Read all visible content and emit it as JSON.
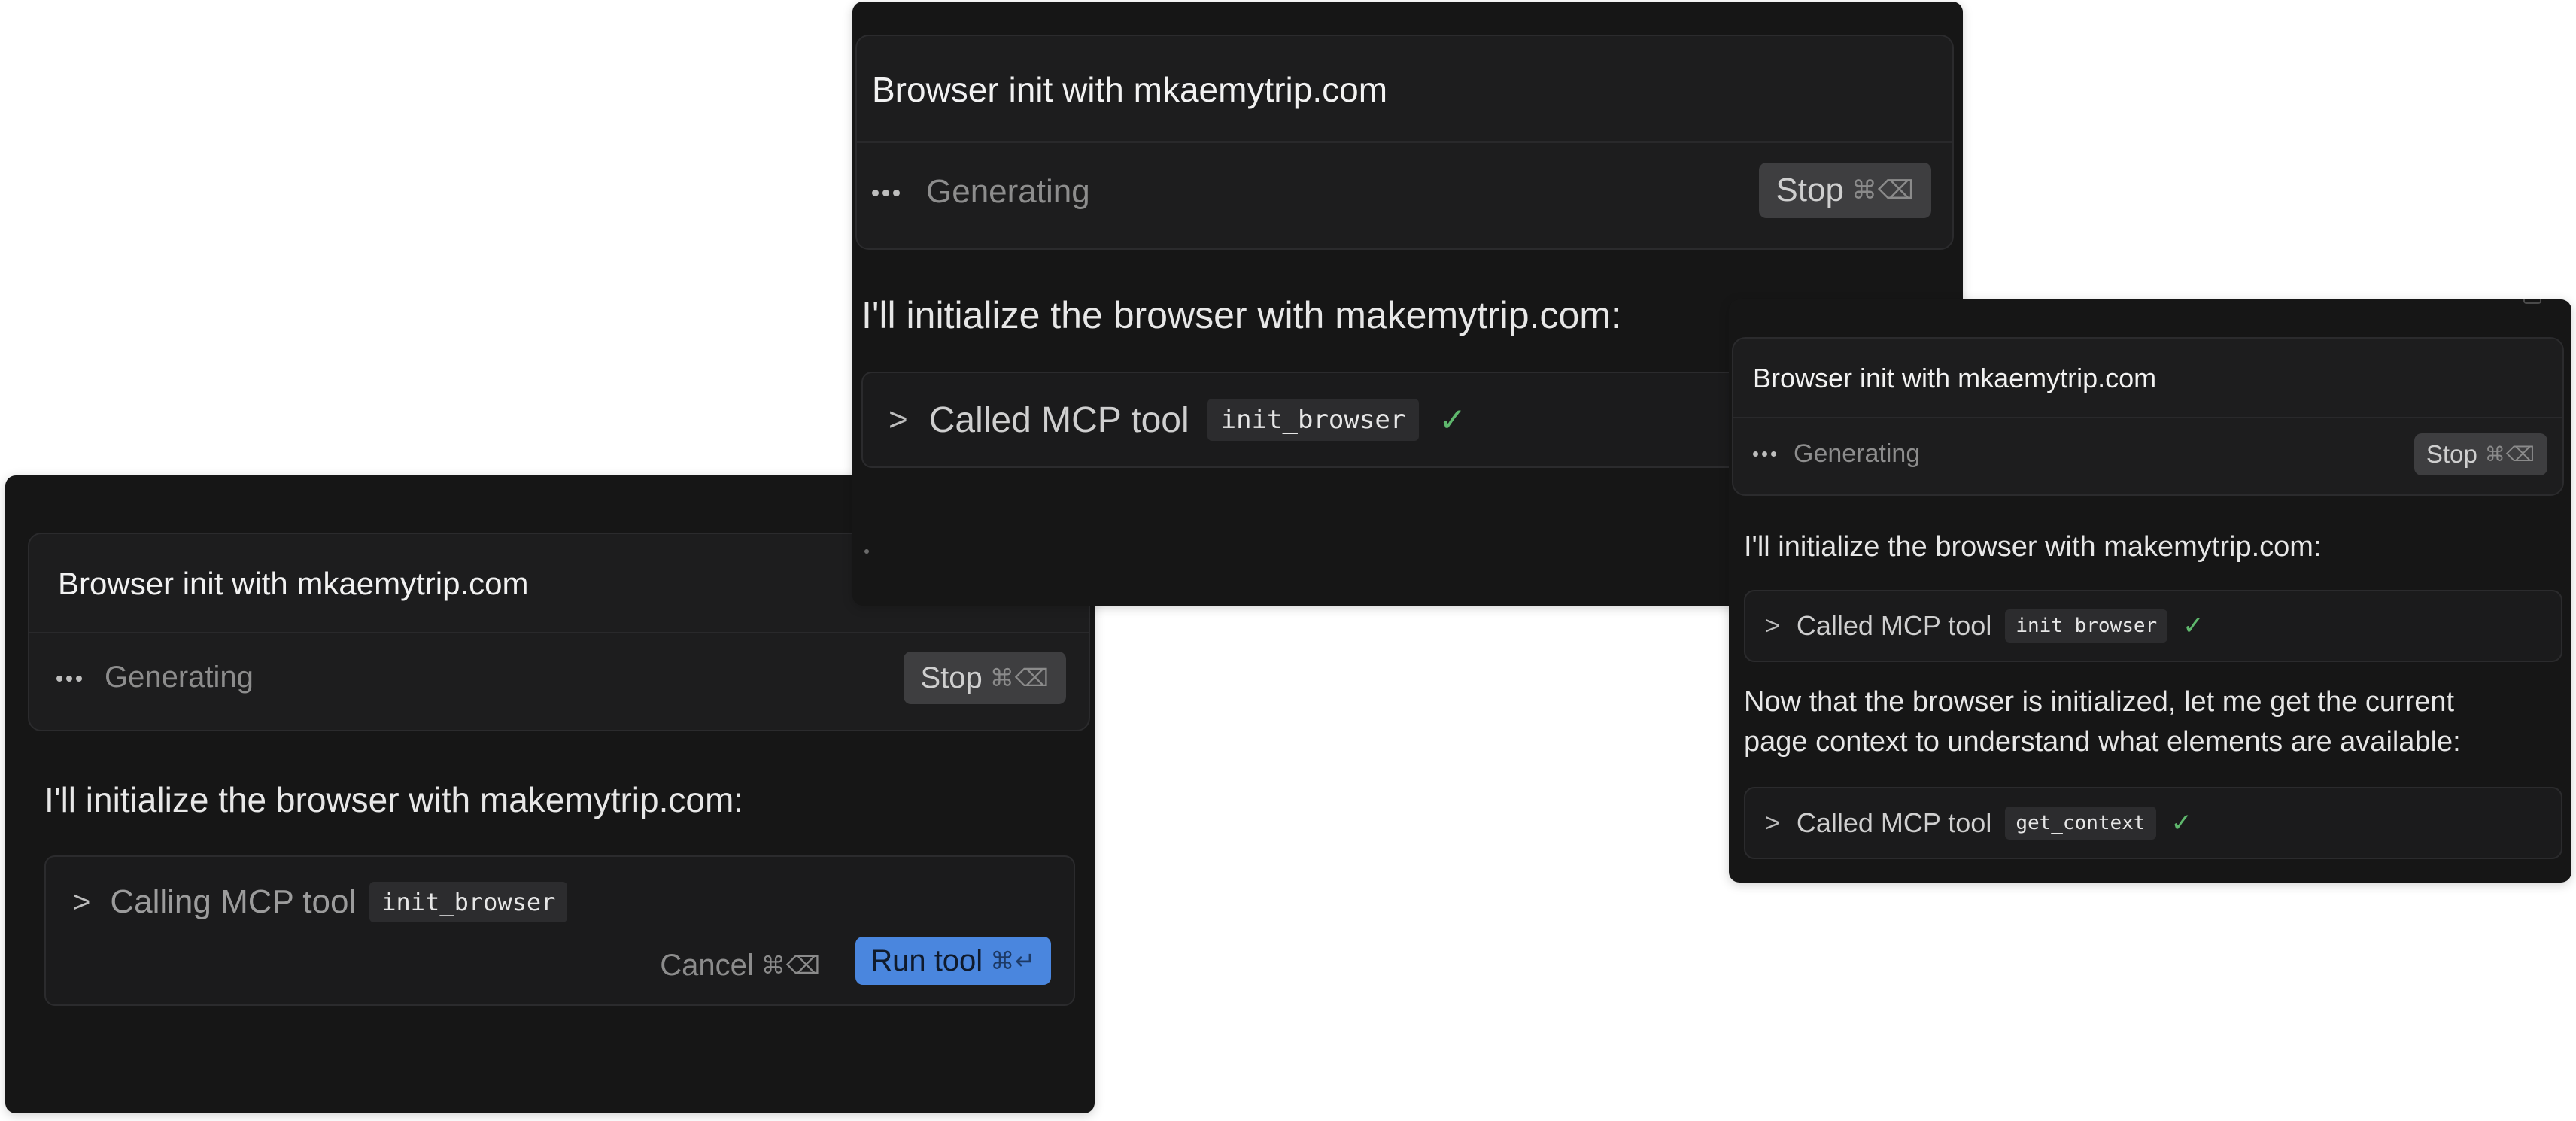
{
  "panel_left": {
    "title": "Browser init with mkaemytrip.com",
    "status": "Generating",
    "stop_label": "Stop",
    "stop_shortcut": "⌘⌫",
    "message": "I'll initialize the browser with makemytrip.com:",
    "tool": {
      "label": "Calling MCP tool",
      "name": "init_browser",
      "cancel_label": "Cancel",
      "cancel_shortcut": "⌘⌫",
      "run_label": "Run tool",
      "run_shortcut": "⌘↵"
    }
  },
  "panel_center": {
    "title": "Browser init with mkaemytrip.com",
    "status": "Generating",
    "stop_label": "Stop",
    "stop_shortcut": "⌘⌫",
    "message": "I'll initialize the browser with makemytrip.com:",
    "tool": {
      "label": "Called MCP tool",
      "name": "init_browser",
      "status_icon": "check-icon"
    }
  },
  "panel_right": {
    "title": "Browser init with mkaemytrip.com",
    "status": "Generating",
    "stop_label": "Stop",
    "stop_shortcut": "⌘⌫",
    "message": "I'll initialize the browser with makemytrip.com:",
    "tool1": {
      "label": "Called MCP tool",
      "name": "init_browser",
      "status_icon": "check-icon"
    },
    "message2_line1": "Now that the browser is initialized, let me get the current",
    "message2_line2": "page context to understand what elements are available:",
    "tool2": {
      "label": "Called MCP tool",
      "name": "get_context",
      "status_icon": "check-icon"
    }
  },
  "colors": {
    "panel_bg": "#161616",
    "card_bg": "#1d1d1e",
    "accent_button": "#4a86de",
    "success_check": "#5fb86d"
  }
}
